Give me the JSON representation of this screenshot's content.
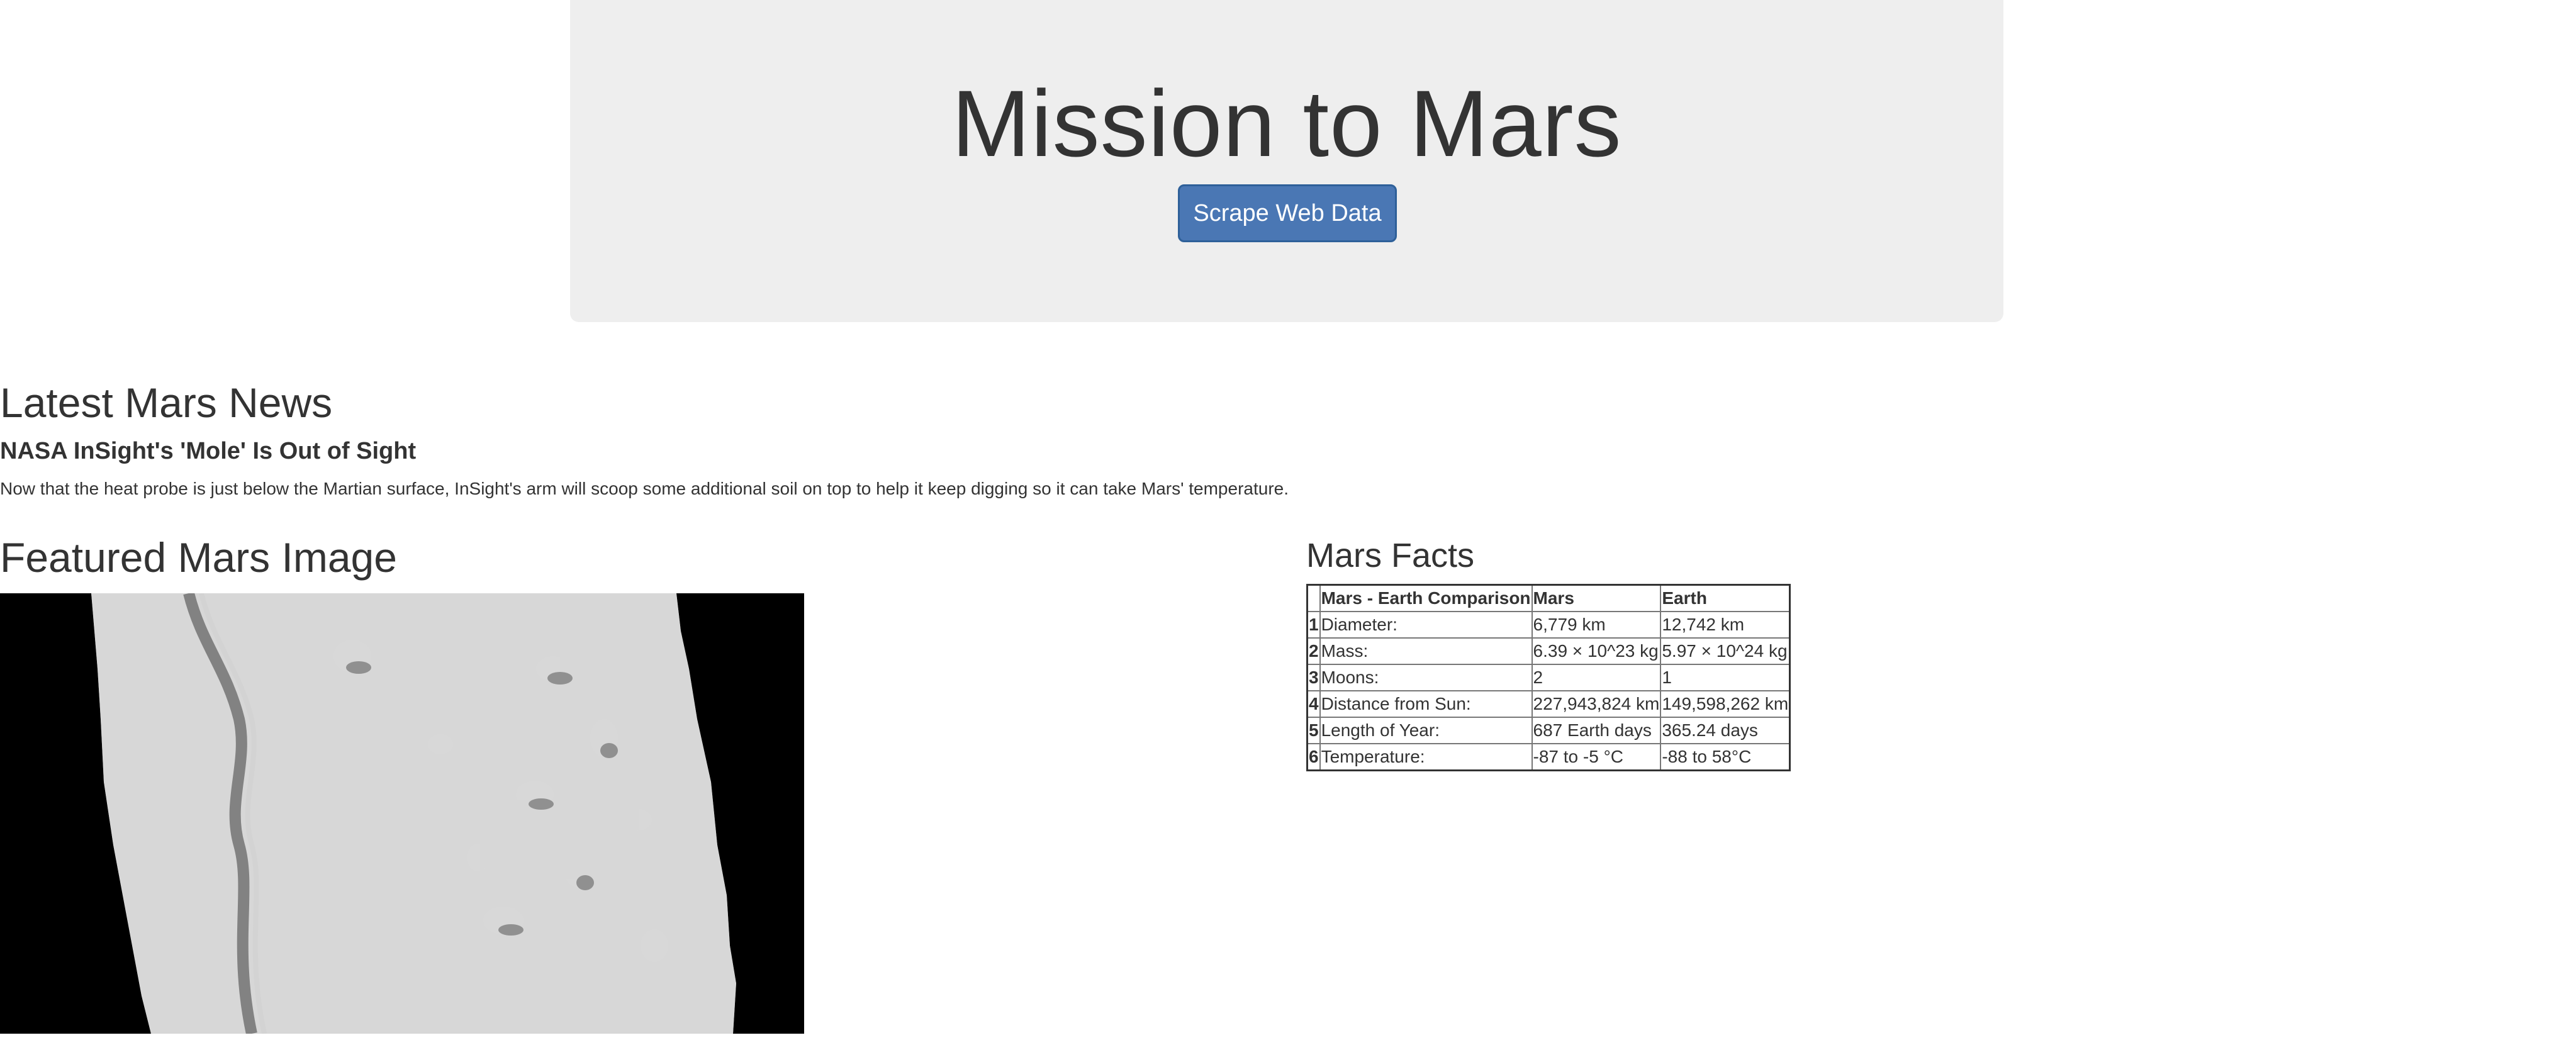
{
  "header": {
    "title": "Mission to Mars",
    "scrape_button_label": "Scrape Web Data"
  },
  "news": {
    "heading": "Latest Mars News",
    "title": "NASA InSight's 'Mole' Is Out of Sight",
    "teaser": "Now that the heat probe is just below the Martian surface, InSight's arm will scoop some additional soil on top to help it keep digging so it can take Mars' temperature."
  },
  "featured": {
    "heading": "Featured Mars Image"
  },
  "facts": {
    "heading": "Mars Facts",
    "columns": [
      "",
      "Mars - Earth Comparison",
      "Mars",
      "Earth"
    ],
    "rows": [
      {
        "index": "1",
        "label": "Diameter:",
        "mars": "6,779 km",
        "earth": "12,742 km"
      },
      {
        "index": "2",
        "label": "Mass:",
        "mars": "6.39 × 10^23 kg",
        "earth": "5.97 × 10^24 kg"
      },
      {
        "index": "3",
        "label": "Moons:",
        "mars": "2",
        "earth": "1"
      },
      {
        "index": "4",
        "label": "Distance from Sun:",
        "mars": "227,943,824 km",
        "earth": "149,598,262 km"
      },
      {
        "index": "5",
        "label": "Length of Year:",
        "mars": "687 Earth days",
        "earth": "365.24 days"
      },
      {
        "index": "6",
        "label": "Temperature:",
        "mars": "-87 to -5 °C",
        "earth": "-88 to 58°C"
      }
    ]
  },
  "colors": {
    "jumbotron_bg": "#eeeeee",
    "button_bg": "#4a77b4",
    "text": "#333333"
  }
}
